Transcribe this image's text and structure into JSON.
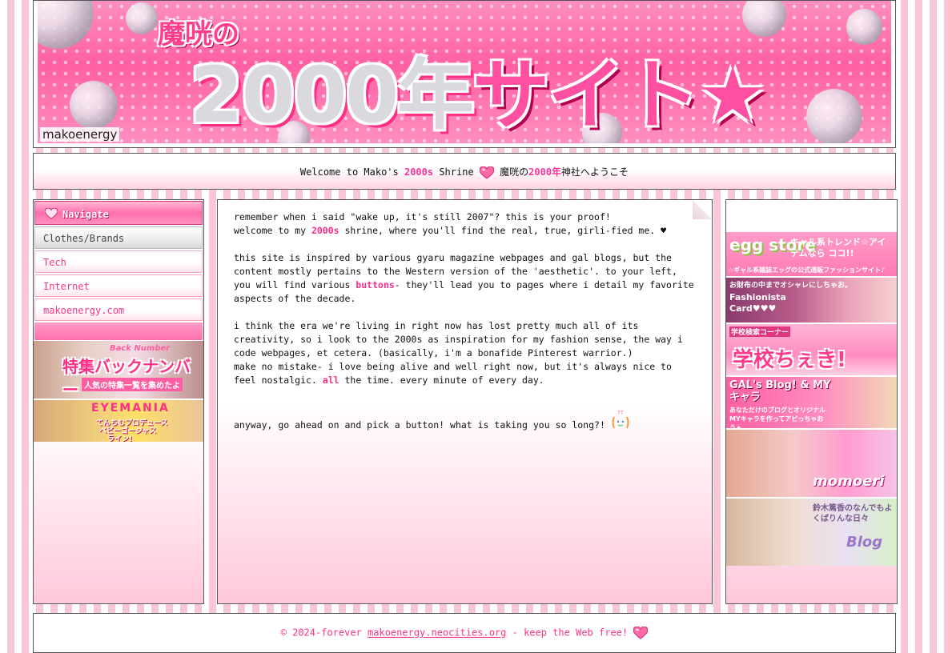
{
  "banner": {
    "title_small": "魔咣の",
    "title_big": "2000年",
    "title_big_pink": "サイト★",
    "credit": "makoenergy"
  },
  "welcome": {
    "prefix": "Welcome to Mako's ",
    "highlight": "2000s",
    "suffix": " Shrine ",
    "jp_a": "魔咣の",
    "jp_highlight": "2000年",
    "jp_b": "神社へようこそ"
  },
  "nav": {
    "title": "Navigate",
    "items": [
      {
        "label": "Clothes/Brands",
        "active": true
      },
      {
        "label": "Tech",
        "active": false
      },
      {
        "label": "Internet",
        "active": false
      },
      {
        "label": "makoenergy.com",
        "active": false
      }
    ],
    "ad1": {
      "line1": "特集バックナンバー",
      "line2": "人気の特集一覧を集めたよ",
      "script": "Back Number"
    },
    "ad2": {
      "line1": "てんちむプロデュース",
      "line2": "ベビーゴージャス",
      "line3": "ライン!",
      "top": "EYEMANIA"
    }
  },
  "main": {
    "p1_line1": "remember when i said \"wake up, it's still 2007\"? this is your proof!",
    "p1_line2_a": "welcome to my ",
    "p1_line2_hl": "2000s",
    "p1_line2_b": " shrine, where you'll find the real, true, girli-fied me. ♥",
    "p2_a": "this site is inspired by various gyaru magazine webpages and gal blogs, but the content mostly pertains to the Western version of the 'aesthetic'. to your left, you will find various ",
    "p2_hl": "buttons",
    "p2_b": "- they'll lead you to pages where i detail my favorite aspects of the decade.",
    "p3_line1": "i think the era we're living in right now has lost pretty much all of its creativity, so i look to the 2000s as inspiration for my fashion sense, the way i code webpages, et cetera. (basically, i'm a bonafide Pinterest warrior.)",
    "p3_line2_a": "make no mistake- i love being alive and well right now, but it's always nice to feel nostalgic. ",
    "p3_line2_hl": "all",
    "p3_line2_b": " the time. every minute of every day.",
    "p4": "anyway, go ahead on and pick a button! what is taking you so long?!"
  },
  "right_ads": [
    {
      "title": "egg store",
      "caption": "キャル系トレンド☆アイテムなら ココ!!",
      "sub": "☆ギャル系雑誌エッグの公式通販ファッションサイト♪"
    },
    {
      "title": "Fashionista Card♥♥♥",
      "caption": "お財布の中までオシャレにしちゃお。"
    },
    {
      "title": "学校ちぇき!",
      "caption": "学校検索コーナー"
    },
    {
      "title": "GAL's Blog! & MYキャラ",
      "caption": "あなただけのブログとオリジナルMYキャラを作ってアピっちゃおう★"
    },
    {
      "title": "momoeri",
      "caption": ""
    },
    {
      "title": "Blog",
      "caption": "鈴木篤香のなんでもよくばりんな日々"
    }
  ],
  "footer": {
    "prefix": "© 2024-forever ",
    "link": "makoenergy.neocities.org",
    "suffix": " - keep the Web free! "
  },
  "colors": {
    "accent": "#ff3399",
    "pink_bg": "#f9c6d6",
    "border": "#555555"
  }
}
